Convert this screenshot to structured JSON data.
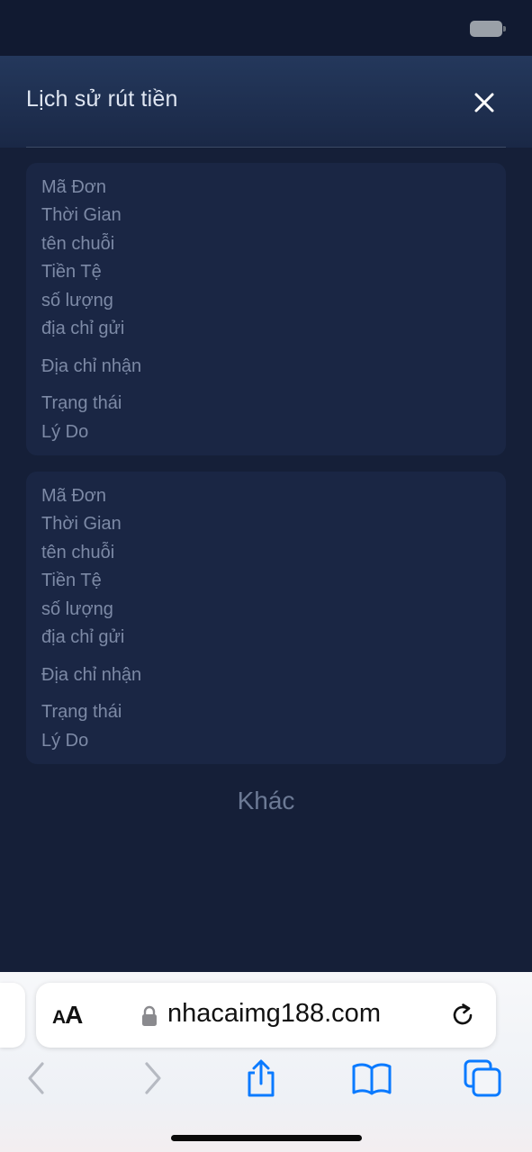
{
  "modal": {
    "title": "Lịch sử rút tiền",
    "records": [
      {
        "fields": [
          "Mã Đơn",
          "Thời Gian",
          "tên chuỗi",
          "Tiền Tệ",
          "số lượng",
          "địa chỉ gửi",
          "Địa chỉ nhận",
          "Trạng thái",
          "Lý Do"
        ]
      },
      {
        "fields": [
          "Mã Đơn",
          "Thời Gian",
          "tên chuỗi",
          "Tiền Tệ",
          "số lượng",
          "địa chỉ gửi",
          "Địa chỉ nhận",
          "Trạng thái",
          "Lý Do"
        ]
      }
    ],
    "more_label": "Khác"
  },
  "browser": {
    "text_size_label_small": "A",
    "text_size_label_large": "A",
    "url": "nhacaimg188.com"
  },
  "colors": {
    "background": "#151f38",
    "card": "#1a2644",
    "label": "#7d8aa6",
    "accent_blue": "#0a7aff"
  }
}
